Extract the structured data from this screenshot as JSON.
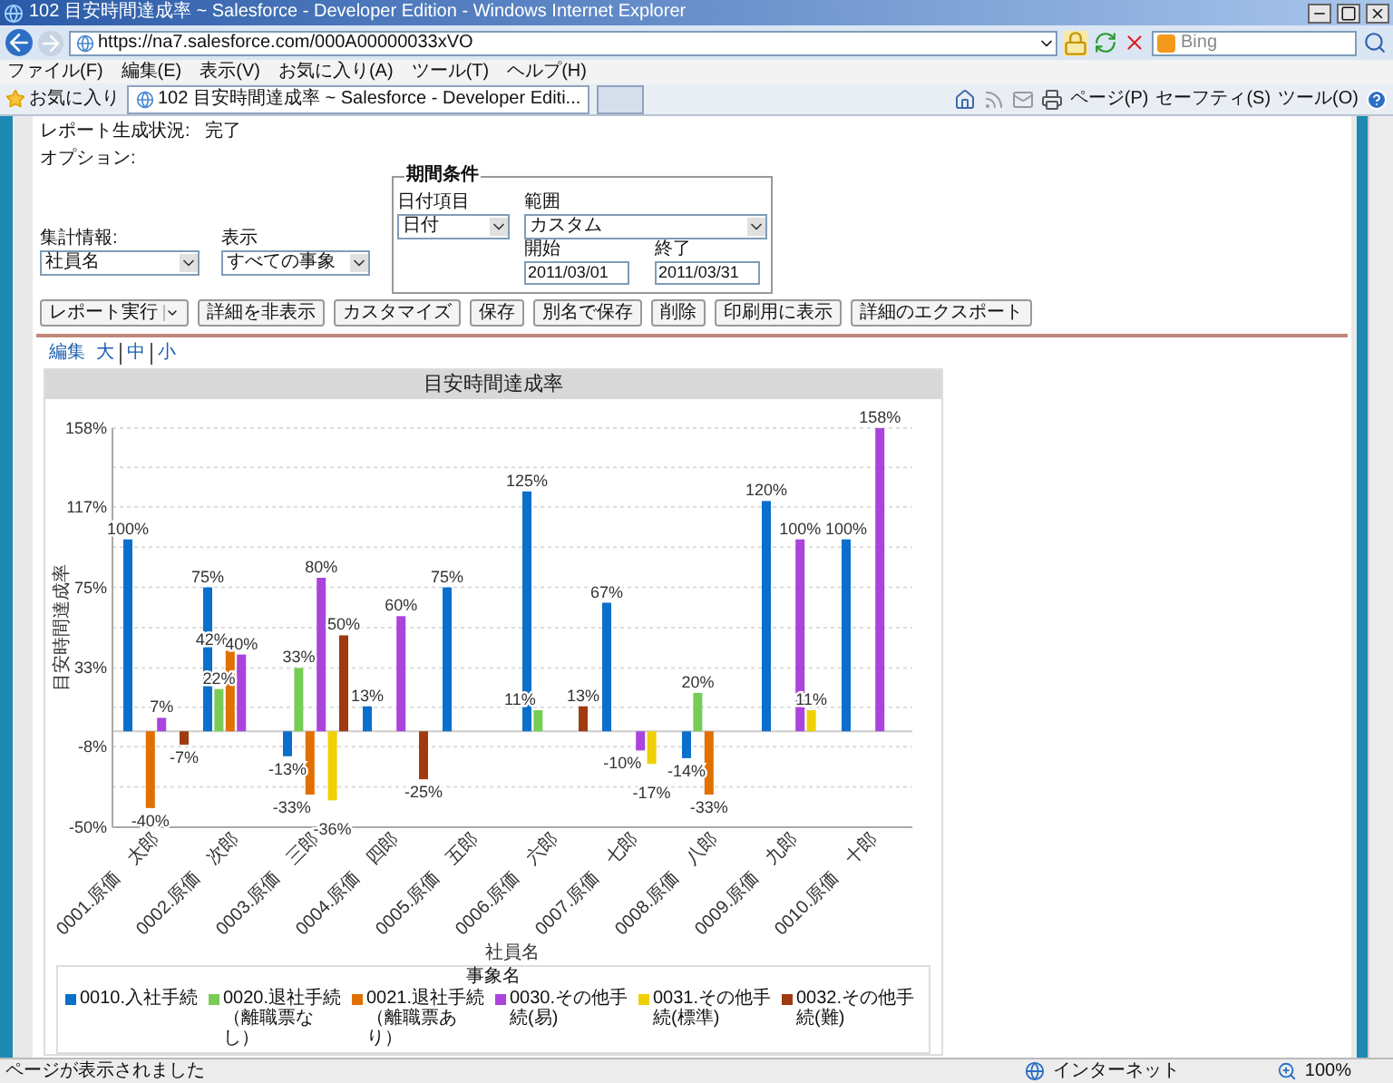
{
  "window": {
    "title": "102 目安時間達成率 ~ Salesforce - Developer Edition - Windows Internet Explorer"
  },
  "address_bar": {
    "url": "https://na7.salesforce.com/000A00000033xVO"
  },
  "search": {
    "placeholder": "Bing"
  },
  "menu": [
    "ファイル(F)",
    "編集(E)",
    "表示(V)",
    "お気に入り(A)",
    "ツール(T)",
    "ヘルプ(H)"
  ],
  "favorites": {
    "label": "お気に入り"
  },
  "tabs": [
    {
      "label": "102 目安時間達成率 ~ Salesforce - Developer Editi...",
      "selected": true
    }
  ],
  "command_bar": [
    "ページ(P)",
    "セーフティ(S)",
    "ツール(O)"
  ],
  "report": {
    "status_label": "レポート生成状況:",
    "status": "完了",
    "options_label": "オプション:",
    "summary": {
      "label": "集計情報:",
      "value": "社員名"
    },
    "show": {
      "label": "表示",
      "value": "すべての事象"
    },
    "period": {
      "legend": "期間条件",
      "date_field": {
        "label": "日付項目",
        "value": "日付"
      },
      "range": {
        "label": "範囲",
        "value": "カスタム"
      },
      "start": {
        "label": "開始",
        "value": "2011/03/01"
      },
      "end": {
        "label": "終了",
        "value": "2011/03/31"
      }
    },
    "buttons": [
      {
        "label": "レポート実行",
        "kind": "split"
      },
      {
        "label": "詳細を非表示",
        "kind": "plain"
      },
      {
        "label": "カスタマイズ",
        "kind": "plain"
      },
      {
        "label": "保存",
        "kind": "plain"
      },
      {
        "label": "別名で保存",
        "kind": "plain"
      },
      {
        "label": "削除",
        "kind": "plain"
      },
      {
        "label": "印刷用に表示",
        "kind": "plain"
      },
      {
        "label": "詳細のエクスポート",
        "kind": "plain"
      }
    ],
    "size_links": [
      "編集",
      "大",
      "中",
      "小"
    ],
    "chart": {
      "chart_data": {
        "type": "bar",
        "legend": {
          "title": "事象名"
        },
        "title": "目安時間達成率",
        "xlabel": "社員名",
        "ylabel": "目安時間達成率",
        "categories": [
          "0001.原価　太郎",
          "0002.原価　次郎",
          "0003.原価　三郎",
          "0004.原価　四郎",
          "0005.原価　五郎",
          "0006.原価　六郎",
          "0007.原価　七郎",
          "0008.原価　八郎",
          "0009.原価　九郎",
          "0010.原価　十郎"
        ],
        "series": [
          {
            "name": "0010.入社手続",
            "color": "#0b6fcc",
            "values": [
              100,
              75,
              -13,
              13,
              75,
              125,
              67,
              -14,
              120,
              100
            ]
          },
          {
            "name": "0020.退社手続（離職票なし）",
            "color": "#77cc55",
            "values": [
              null,
              22,
              33,
              null,
              null,
              11,
              null,
              20,
              null,
              null
            ]
          },
          {
            "name": "0021.退社手続（離職票あり）",
            "color": "#e07000",
            "values": [
              -40,
              42,
              -33,
              null,
              null,
              null,
              null,
              -33,
              null,
              null
            ]
          },
          {
            "name": "0030.その他手続(易)",
            "color": "#aa44dd",
            "values": [
              7,
              40,
              80,
              60,
              null,
              null,
              -10,
              null,
              100,
              158
            ]
          },
          {
            "name": "0031.その他手続(標準)",
            "color": "#f0d000",
            "values": [
              null,
              null,
              -36,
              null,
              null,
              null,
              -17,
              null,
              11,
              null
            ]
          },
          {
            "name": "0032.その他手続(難)",
            "color": "#a03a10",
            "values": [
              -7,
              null,
              50,
              -25,
              null,
              13,
              null,
              null,
              null,
              null
            ]
          }
        ],
        "value_labels": [
          [
            "100%",
            "75%",
            "-13%",
            "13%",
            "75%",
            "125%",
            "67%",
            "-14%",
            "120%",
            "100%"
          ],
          [
            null,
            "22%",
            "33%",
            null,
            null,
            "11%",
            null,
            "20%",
            null,
            null
          ],
          [
            "-40%",
            "42%",
            "-33%",
            null,
            null,
            null,
            null,
            "-33%",
            null,
            null
          ],
          [
            "7%",
            "40%",
            "80%",
            "60%",
            null,
            null,
            "-10%",
            null,
            "100%",
            "158%"
          ],
          [
            null,
            null,
            "-36%",
            null,
            null,
            null,
            "-17%",
            null,
            "11%",
            null
          ],
          [
            "-7%",
            null,
            "50%",
            "-25%",
            null,
            "13%",
            null,
            null,
            null,
            null
          ]
        ],
        "ylim": [
          -50,
          158
        ],
        "grid": true,
        "yticks": [
          {
            "value": 158,
            "label": "158%"
          },
          {
            "value": 117,
            "label": "117%"
          },
          {
            "value": 75,
            "label": "75%"
          },
          {
            "value": 33,
            "label": "33%"
          },
          {
            "value": -8,
            "label": "-8%"
          },
          {
            "value": -50,
            "label": "-50%"
          }
        ]
      }
    }
  },
  "status_bar": {
    "text": "ページが表示されました",
    "zone": "インターネット",
    "zoom": "100%"
  }
}
